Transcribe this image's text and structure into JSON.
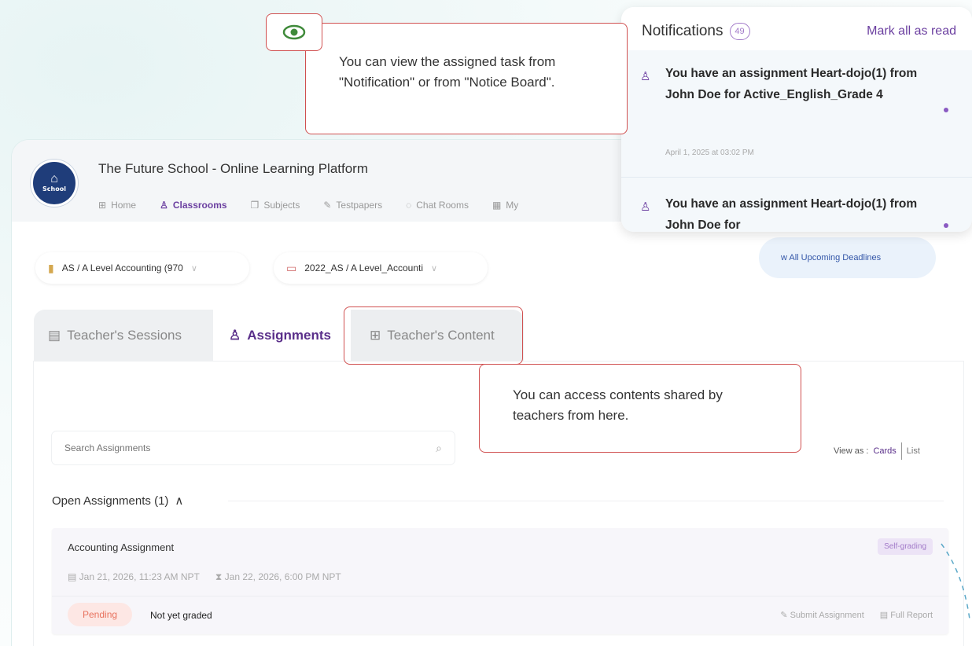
{
  "app": {
    "title": "The Future School - Online Learning Platform",
    "logo_text": "School"
  },
  "nav": [
    {
      "label": "Home",
      "icon": "grid-icon",
      "active": false
    },
    {
      "label": "Classrooms",
      "icon": "classroom-icon",
      "active": true
    },
    {
      "label": "Subjects",
      "icon": "book-icon",
      "active": false
    },
    {
      "label": "Testpapers",
      "icon": "testpaper-icon",
      "active": false
    },
    {
      "label": "Chat Rooms",
      "icon": "chat-icon",
      "active": false
    },
    {
      "label": "My",
      "icon": "calendar-icon",
      "active": false
    }
  ],
  "selectors": {
    "subject": "AS / A Level Accounting (970",
    "class": "2022_AS / A Level_Accounti"
  },
  "tabs": {
    "sessions": "Teacher's Sessions",
    "assignments": "Assignments",
    "content": "Teacher's Content"
  },
  "toolbar": {
    "deadlines_label": "w All Upcoming Deadlines",
    "search_placeholder": "Search Assignments",
    "view_as_label": "View as :",
    "view_cards": "Cards",
    "view_list": "List"
  },
  "open_assignments": {
    "heading": "Open Assignments (1)",
    "items": [
      {
        "title": "Accounting Assignment",
        "badge": "Self-grading",
        "start": "Jan 21, 2026, 11:23 AM NPT",
        "due": "Jan 22, 2026, 6:00 PM NPT",
        "status": "Pending",
        "grade_status": "Not yet graded",
        "submit_label": "Submit Assignment",
        "report_label": "Full Report"
      }
    ]
  },
  "notifications": {
    "title": "Notifications",
    "count": "49",
    "mark_all_label": "Mark all as read",
    "items": [
      {
        "message": "You have an assignment Heart-dojo(1) from John Doe for Active_English_Grade 4",
        "time": "April 1, 2025 at 03:02 PM"
      },
      {
        "message": "You have an assignment Heart-dojo(1) from John Doe for",
        "time": ""
      }
    ]
  },
  "callouts": {
    "notification_tip": "You can view the assigned task from \"Notification\" or from \"Notice Board\".",
    "content_tip": "You can access contents shared by teachers from here."
  },
  "colors": {
    "brand_purple": "#6b3fa0",
    "highlight_red": "#d05050",
    "pending_bg": "#fde7e4",
    "pending_text": "#e8735f"
  }
}
